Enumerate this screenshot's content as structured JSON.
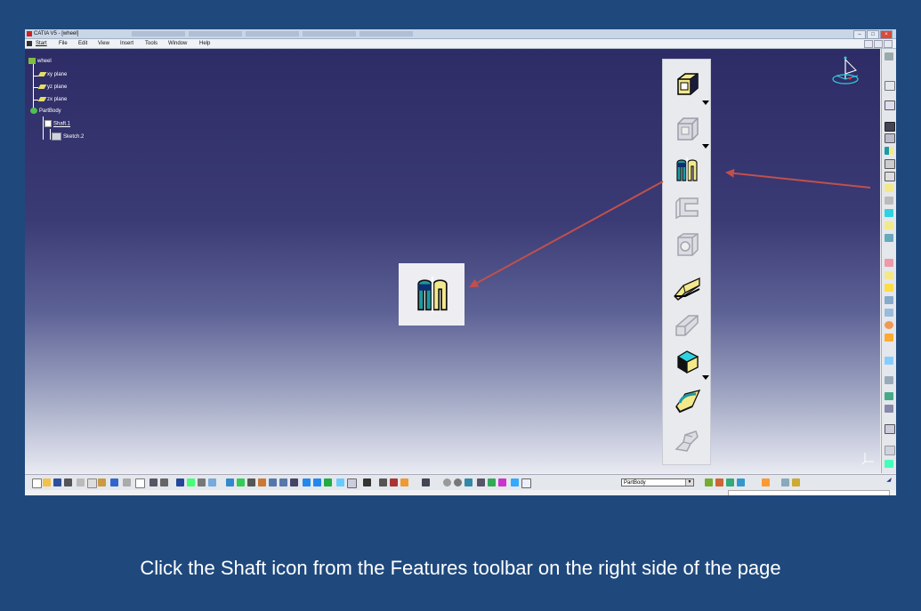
{
  "window": {
    "title": "CATIA V5 - [wheel]"
  },
  "menu": {
    "items": [
      "Start",
      "File",
      "Edit",
      "View",
      "Insert",
      "Tools",
      "Window",
      "Help"
    ]
  },
  "tree": {
    "root": "wheel",
    "planes": [
      "xy plane",
      "yz plane",
      "zx plane"
    ],
    "body": "PartBody",
    "shaft": "Shaft.1",
    "sketch": "Sketch.2"
  },
  "toolbar": {
    "active_body": "PartBody"
  },
  "caption": "Click the Shaft icon from the Features toolbar on the right side of the page",
  "colors": {
    "background": "#1f497d",
    "arrow": "#c0504d",
    "accent_yellow": "#f3e98a",
    "accent_teal": "#1b9aa3"
  },
  "icons": [
    "pad-icon",
    "pocket-icon",
    "shaft-icon",
    "groove-icon",
    "hole-icon",
    "rib-icon",
    "slot-icon",
    "multi-section-solid-icon",
    "removed-multi-section-solid-icon",
    "stiffener-icon"
  ]
}
